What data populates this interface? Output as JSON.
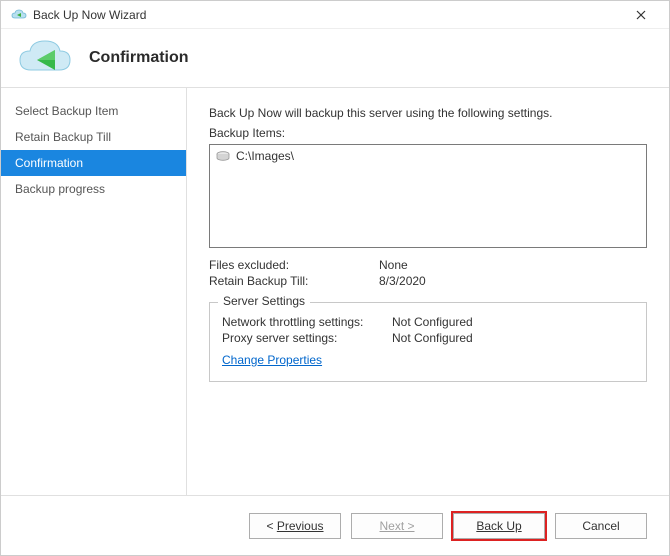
{
  "window": {
    "title": "Back Up Now Wizard"
  },
  "header": {
    "heading": "Confirmation"
  },
  "sidebar": {
    "steps": [
      {
        "label": "Select Backup Item"
      },
      {
        "label": "Retain Backup Till"
      },
      {
        "label": "Confirmation"
      },
      {
        "label": "Backup progress"
      }
    ],
    "active_index": 2
  },
  "content": {
    "intro": "Back Up Now will backup this server using the following settings.",
    "items_label": "Backup Items:",
    "items": [
      {
        "path": "C:\\Images\\"
      }
    ],
    "files_excluded_label": "Files excluded:",
    "files_excluded_value": "None",
    "retain_till_label": "Retain Backup Till:",
    "retain_till_value": "8/3/2020",
    "server_settings": {
      "legend": "Server Settings",
      "network_throttling_label": "Network throttling settings:",
      "network_throttling_value": "Not Configured",
      "proxy_label": "Proxy server settings:",
      "proxy_value": "Not Configured",
      "change_link": "Change Properties"
    }
  },
  "footer": {
    "previous": "Previous",
    "next": "Next >",
    "backup": "Back Up",
    "cancel": "Cancel"
  }
}
